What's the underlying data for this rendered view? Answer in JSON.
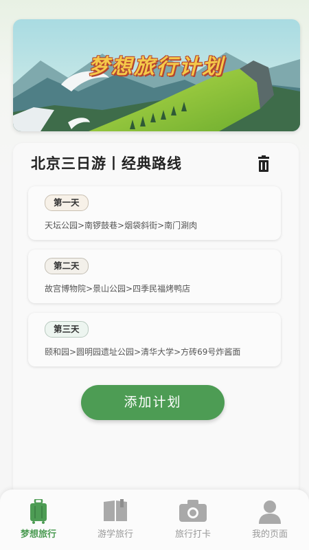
{
  "banner": {
    "title": "梦想旅行计划"
  },
  "plan": {
    "title": "北京三日游丨经典路线",
    "days": [
      {
        "label": "第一天",
        "route": "天坛公园>南锣鼓巷>烟袋斜街>南门涮肉"
      },
      {
        "label": "第二天",
        "route": "故宫博物院>景山公园>四季民福烤鸭店"
      },
      {
        "label": "第三天",
        "route": "颐和园>圆明园遗址公园>清华大学>方砖69号炸酱面"
      }
    ]
  },
  "actions": {
    "add_label": "添加计划"
  },
  "tabs": [
    {
      "label": "梦想旅行",
      "icon": "luggage-icon",
      "active": true
    },
    {
      "label": "游学旅行",
      "icon": "book-icon",
      "active": false
    },
    {
      "label": "旅行打卡",
      "icon": "camera-icon",
      "active": false
    },
    {
      "label": "我的页面",
      "icon": "user-icon",
      "active": false
    }
  ],
  "colors": {
    "accent": "#4d9c54",
    "inactive": "#999999",
    "banner_title": "#f5c94a"
  }
}
